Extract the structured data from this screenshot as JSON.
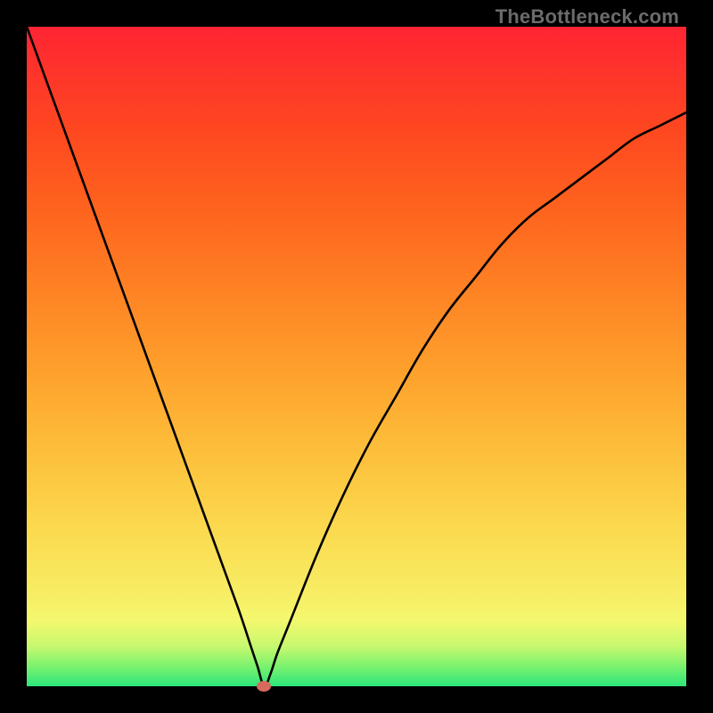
{
  "watermark": "TheBottleneck.com",
  "colors": {
    "curve": "#000000",
    "marker": "#D66A5C",
    "frame": "#000000"
  },
  "chart_data": {
    "type": "line",
    "title": "",
    "xlabel": "",
    "ylabel": "",
    "xlim": [
      0,
      100
    ],
    "ylim": [
      0,
      100
    ],
    "grid": false,
    "legend": false,
    "optimum": {
      "x": 36,
      "y": 0
    },
    "series": [
      {
        "name": "bottleneck-curve",
        "x": [
          0,
          4,
          8,
          12,
          16,
          20,
          24,
          28,
          32,
          34,
          35,
          36,
          37,
          38,
          40,
          44,
          48,
          52,
          56,
          60,
          64,
          68,
          72,
          76,
          80,
          84,
          88,
          92,
          96,
          100
        ],
        "y": [
          100,
          89,
          78,
          67,
          56,
          45,
          34,
          23,
          12,
          6,
          3,
          0,
          2,
          5,
          10,
          20,
          29,
          37,
          44,
          51,
          57,
          62,
          67,
          71,
          74,
          77,
          80,
          83,
          85,
          87
        ]
      }
    ]
  }
}
